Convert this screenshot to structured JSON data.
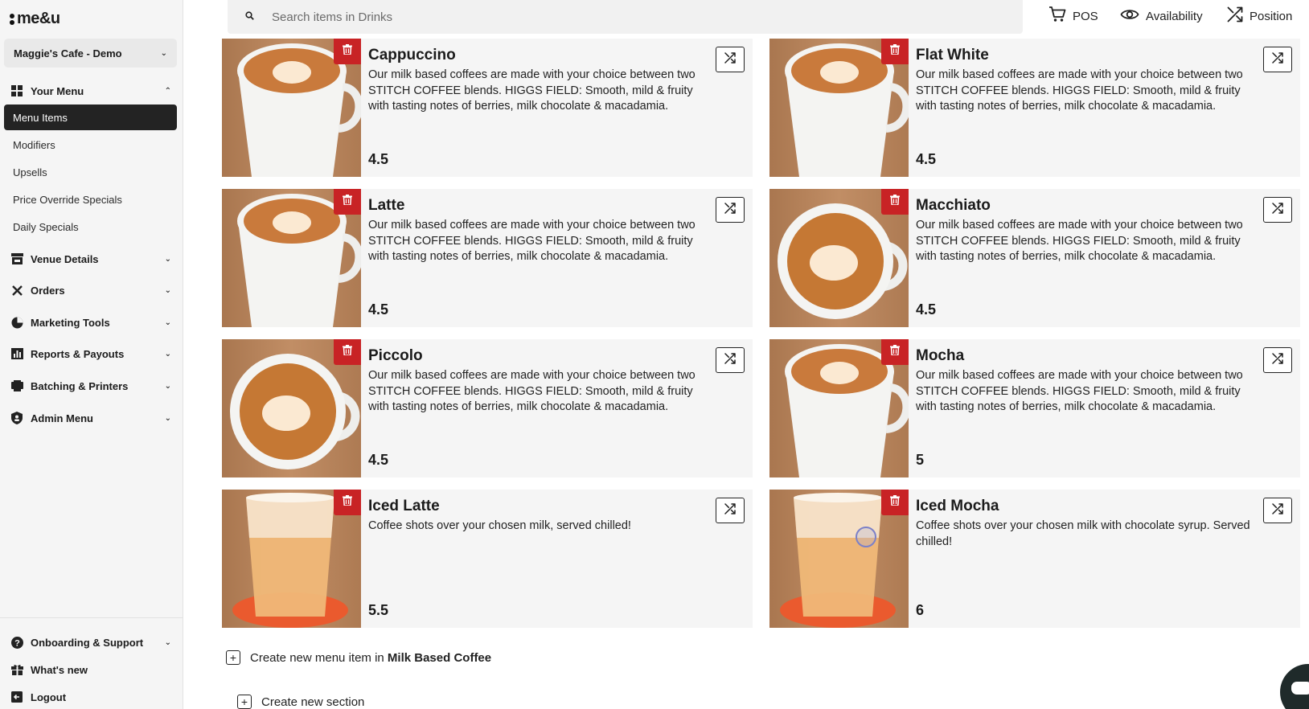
{
  "brand": {
    "logo_text": "me&u"
  },
  "venue": {
    "name": "Maggie's Cafe - Demo"
  },
  "sidebar": {
    "your_menu": "Your Menu",
    "sub_items": [
      "Menu Items",
      "Modifiers",
      "Upsells",
      "Price Override Specials",
      "Daily Specials"
    ],
    "sections": [
      "Venue Details",
      "Orders",
      "Marketing Tools",
      "Reports & Payouts",
      "Batching & Printers",
      "Admin Menu"
    ],
    "bottom": {
      "support": "Onboarding & Support",
      "whats_new": "What's new",
      "logout": "Logout"
    }
  },
  "search": {
    "placeholder": "Search items in Drinks"
  },
  "top_actions": {
    "pos": "POS",
    "availability": "Availability",
    "position": "Position"
  },
  "items": [
    {
      "name": "Cappuccino",
      "desc": "Our milk based coffees are made with your choice between two STITCH COFFEE blends. HIGGS FIELD: Smooth, mild & fruity with tasting notes of berries, milk chocolate & macadamia. HOBNOB:...",
      "price": "4.5"
    },
    {
      "name": "Flat White",
      "desc": "Our milk based coffees are made with your choice between two STITCH COFFEE blends. HIGGS FIELD: Smooth, mild & fruity with tasting notes of berries, milk chocolate & macadamia. HOBNOB:...",
      "price": "4.5"
    },
    {
      "name": "Latte",
      "desc": "Our milk based coffees are made with your choice between two STITCH COFFEE blends. HIGGS FIELD: Smooth, mild & fruity with tasting notes of berries, milk chocolate & macadamia. HOBNOB:...",
      "price": "4.5"
    },
    {
      "name": "Macchiato",
      "desc": "Our milk based coffees are made with your choice between two STITCH COFFEE blends. HIGGS FIELD: Smooth, mild & fruity with tasting notes of berries, milk chocolate & macadamia. HOBNOB:...",
      "price": "4.5"
    },
    {
      "name": "Piccolo",
      "desc": "Our milk based coffees are made with your choice between two STITCH COFFEE blends. HIGGS FIELD: Smooth, mild & fruity with tasting notes of berries, milk chocolate & macadamia. HOBNOB:...",
      "price": "4.5"
    },
    {
      "name": "Mocha",
      "desc": "Our milk based coffees are made with your choice between two STITCH COFFEE blends. HIGGS FIELD: Smooth, mild & fruity with tasting notes of berries, milk chocolate & macadamia. HOBNOB:...",
      "price": "5"
    },
    {
      "name": "Iced Latte",
      "desc": "Coffee shots over your chosen milk, served chilled!",
      "price": "5.5"
    },
    {
      "name": "Iced Mocha",
      "desc": "Coffee shots over your chosen milk with chocolate syrup. Served chilled!",
      "price": "6"
    }
  ],
  "create": {
    "item_prefix": "Create new menu item in",
    "item_section": "Milk Based Coffee",
    "section": "Create new section"
  },
  "colors": {
    "delete": "#c82325",
    "active_nav": "#232323",
    "sidebar_bg": "#f5f5f5"
  }
}
